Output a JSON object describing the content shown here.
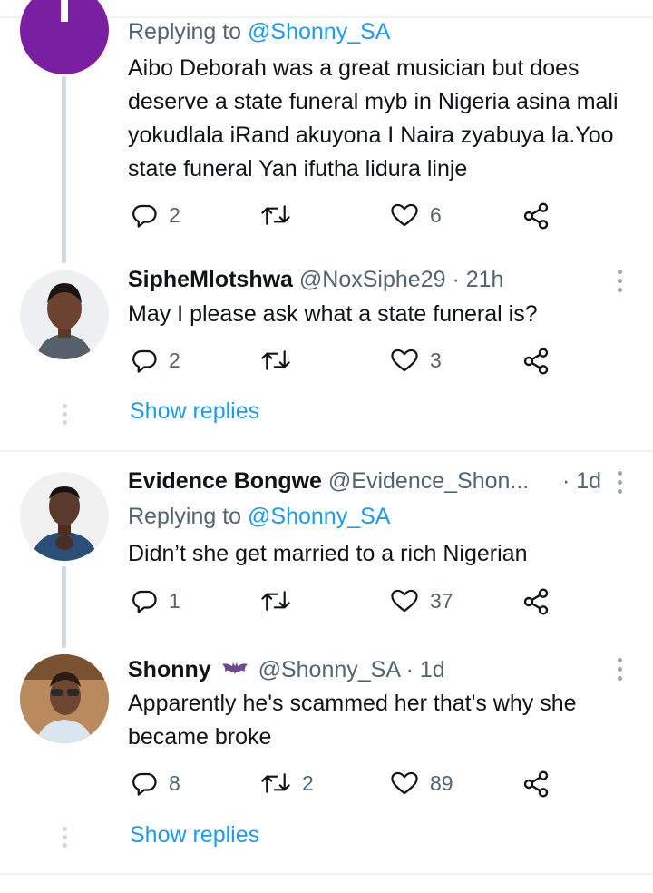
{
  "tweets": [
    {
      "replying_prefix": "Replying to",
      "replying_handle": "@Shonny_SA",
      "text": "Aibo Deborah was a great musician but does deserve a state funeral myb in Nigeria asina mali yokudlala iRand akuyona I Naira zyabuya la.Yoo state funeral Yan ifutha lidura linje",
      "replies": "2",
      "retweets": "",
      "likes": "6",
      "avatar_color": "#7b1fa2"
    },
    {
      "name": "SipheMlotshwa",
      "handle": "@NoxSiphe29",
      "time": "· 21h",
      "text": "May I please ask what a state funeral is?",
      "replies": "2",
      "retweets": "",
      "likes": "3"
    },
    {
      "name": "Evidence Bongwe",
      "handle": "@Evidence_Shon...",
      "time": "· 1d",
      "replying_prefix": "Replying to",
      "replying_handle": "@Shonny_SA",
      "text": "Didn’t she get married to a rich Nigerian",
      "replies": "1",
      "retweets": "",
      "likes": "37"
    },
    {
      "name": "Shonny",
      "badge": "bat-emoji",
      "handle": "@Shonny_SA",
      "time": "· 1d",
      "text": "Apparently he's scammed her that's why she became broke",
      "replies": "8",
      "retweets": "2",
      "likes": "89"
    }
  ],
  "show_replies_1": "Show replies",
  "show_replies_2": "Show replies",
  "icons": {
    "reply": "reply-icon",
    "retweet": "retweet-icon",
    "like": "heart-icon",
    "share": "share-icon",
    "more": "more-options-icon"
  },
  "colors": {
    "link": "#1d9bf0",
    "secondary_text": "#536471",
    "thread_line": "#cfd9de"
  }
}
